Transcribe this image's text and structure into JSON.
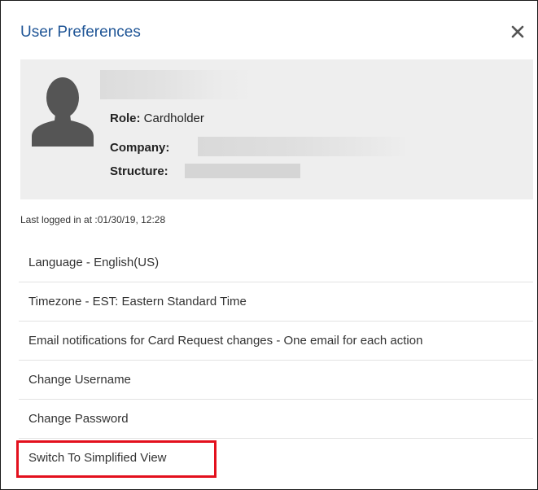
{
  "dialog": {
    "title": "User Preferences",
    "close_icon": "close-icon"
  },
  "profile": {
    "avatar_icon": "user-silhouette-icon",
    "role_label": "Role:",
    "role_value": "Cardholder",
    "company_label": "Company:",
    "structure_label": "Structure:"
  },
  "last_login": "Last logged in at :01/30/19, 12:28",
  "menu": {
    "items": [
      {
        "label": "Language - English(US)"
      },
      {
        "label": "Timezone - EST: Eastern Standard Time"
      },
      {
        "label": "Email notifications for Card Request changes - One email for each action"
      },
      {
        "label": "Change Username"
      },
      {
        "label": "Change Password"
      },
      {
        "label": "Switch To Simplified View"
      }
    ]
  },
  "colors": {
    "title": "#1f5596",
    "profile_bg": "#eeeeee",
    "highlight": "#e3101d"
  }
}
